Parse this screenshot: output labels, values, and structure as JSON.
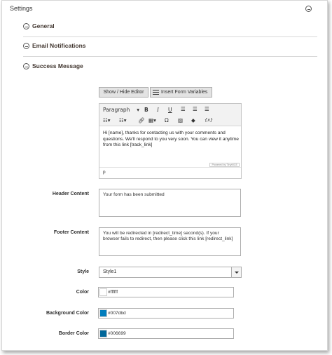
{
  "page": {
    "title": "Settings"
  },
  "sections": [
    {
      "label": "General"
    },
    {
      "label": "Email Notifications"
    },
    {
      "label": "Success Message"
    }
  ],
  "editor_buttons": {
    "show_hide": "Show / Hide Editor",
    "insert_vars": "Insert Form Variables"
  },
  "editor": {
    "format": "Paragraph",
    "body": "Hi [name], thanks for contacting us with your comments and questions. We'll respond to you very soon. You can view it anytime from this link [track_link]",
    "powered_by": "Powered by TinyMCE",
    "status_path": "p",
    "toolbar_icons": [
      "bold-icon",
      "italic-icon",
      "underline-icon",
      "align-left-icon",
      "align-center-icon",
      "align-right-icon",
      "bullet-list-icon",
      "numbered-list-icon",
      "link-icon",
      "table-icon",
      "special-char-icon",
      "image-icon",
      "widget-icon",
      "variable-icon"
    ]
  },
  "fields": {
    "header_content": {
      "label": "Header Content",
      "value": "Your form has been submitted"
    },
    "footer_content": {
      "label": "Footer Content",
      "value": "You will be redirected in [redirect_time] second(s). If your browser fails to redirect, then please click this link [redirect_link]"
    },
    "style": {
      "label": "Style",
      "value": "Style1"
    },
    "color": {
      "label": "Color",
      "value": "#ffffff"
    },
    "background_color": {
      "label": "Background Color",
      "value": "#007dbd"
    },
    "border_color": {
      "label": "Border Color",
      "value": "#006699"
    }
  }
}
